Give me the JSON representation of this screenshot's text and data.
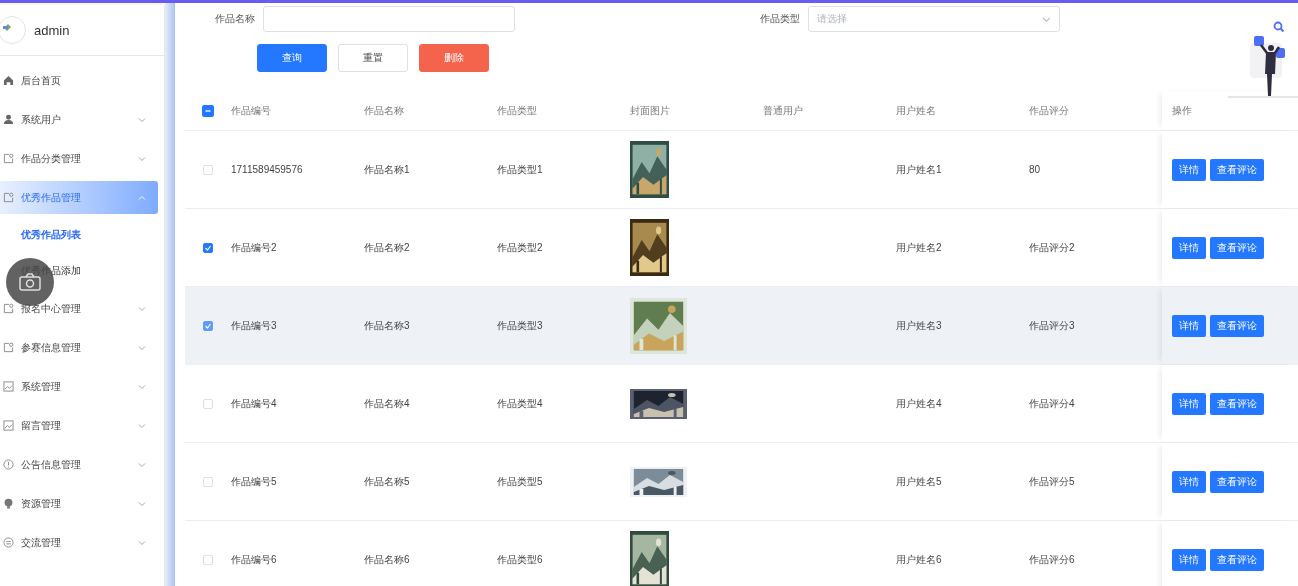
{
  "user": {
    "name": "admin"
  },
  "sidebar": {
    "items": [
      {
        "label": "后台首页",
        "kind": "link",
        "selected": false
      },
      {
        "label": "系统用户",
        "kind": "group",
        "expanded": false,
        "selected": false
      },
      {
        "label": "作品分类管理",
        "kind": "group",
        "expanded": false,
        "selected": false
      },
      {
        "label": "优秀作品管理",
        "kind": "group",
        "expanded": true,
        "selected": true,
        "children": [
          {
            "label": "优秀作品列表",
            "selected": true
          },
          {
            "label": "优秀作品添加",
            "selected": false
          }
        ]
      },
      {
        "label": "报名中心管理",
        "kind": "group",
        "expanded": false,
        "selected": false
      },
      {
        "label": "参赛信息管理",
        "kind": "group",
        "expanded": false,
        "selected": false
      },
      {
        "label": "系统管理",
        "kind": "group",
        "expanded": false,
        "selected": false
      },
      {
        "label": "留言管理",
        "kind": "group",
        "expanded": false,
        "selected": false
      },
      {
        "label": "公告信息管理",
        "kind": "group",
        "expanded": false,
        "selected": false
      },
      {
        "label": "资源管理",
        "kind": "group",
        "expanded": false,
        "selected": false
      },
      {
        "label": "交流管理",
        "kind": "group",
        "expanded": false,
        "selected": false
      }
    ]
  },
  "search": {
    "fields": [
      {
        "label": "作品名称",
        "kind": "input"
      },
      {
        "label": "作品类型",
        "kind": "select",
        "placeholder": "请选择"
      }
    ],
    "buttons": [
      {
        "label": "查询",
        "kind": "primary"
      },
      {
        "label": "重置",
        "kind": "plain"
      },
      {
        "label": "删除",
        "kind": "danger"
      }
    ]
  },
  "table": {
    "select_all_indeterminate": true,
    "columns": [
      "作品编号",
      "作品名称",
      "作品类型",
      "封面图片",
      "普通用户",
      "用户姓名",
      "作品评分",
      "操作"
    ],
    "rows": [
      {
        "checked": false,
        "hovered": false,
        "cells": [
          "1711589459576",
          "作品名称1",
          "作品类型1",
          {
            "kind": "picture"
          },
          null,
          "用户姓名1",
          "80"
        ],
        "actions": [
          "详情",
          "查看评论"
        ]
      },
      {
        "checked": true,
        "hovered": false,
        "cells": [
          "作品编号2",
          "作品名称2",
          "作品类型2",
          {
            "kind": "picture"
          },
          null,
          "用户姓名2",
          "作品评分2"
        ],
        "actions": [
          "详情",
          "查看评论"
        ]
      },
      {
        "checked": true,
        "hovered": true,
        "cells": [
          "作品编号3",
          "作品名称3",
          "作品类型3",
          {
            "kind": "picture"
          },
          null,
          "用户姓名3",
          "作品评分3"
        ],
        "actions": [
          "详情",
          "查看评论"
        ]
      },
      {
        "checked": false,
        "hovered": false,
        "cells": [
          "作品编号4",
          "作品名称4",
          "作品类型4",
          {
            "kind": "picture"
          },
          null,
          "用户姓名4",
          "作品评分4"
        ],
        "actions": [
          "详情",
          "查看评论"
        ]
      },
      {
        "checked": false,
        "hovered": false,
        "cells": [
          "作品编号5",
          "作品名称5",
          "作品类型5",
          {
            "kind": "picture"
          },
          null,
          "用户姓名5",
          "作品评分5"
        ],
        "actions": [
          "详情",
          "查看评论"
        ]
      },
      {
        "checked": false,
        "hovered": false,
        "cells": [
          "作品编号6",
          "作品名称6",
          "作品类型6",
          {
            "kind": "picture"
          },
          null,
          "用户姓名6",
          "作品评分6"
        ],
        "actions": [
          "详情",
          "查看评论"
        ]
      }
    ]
  }
}
